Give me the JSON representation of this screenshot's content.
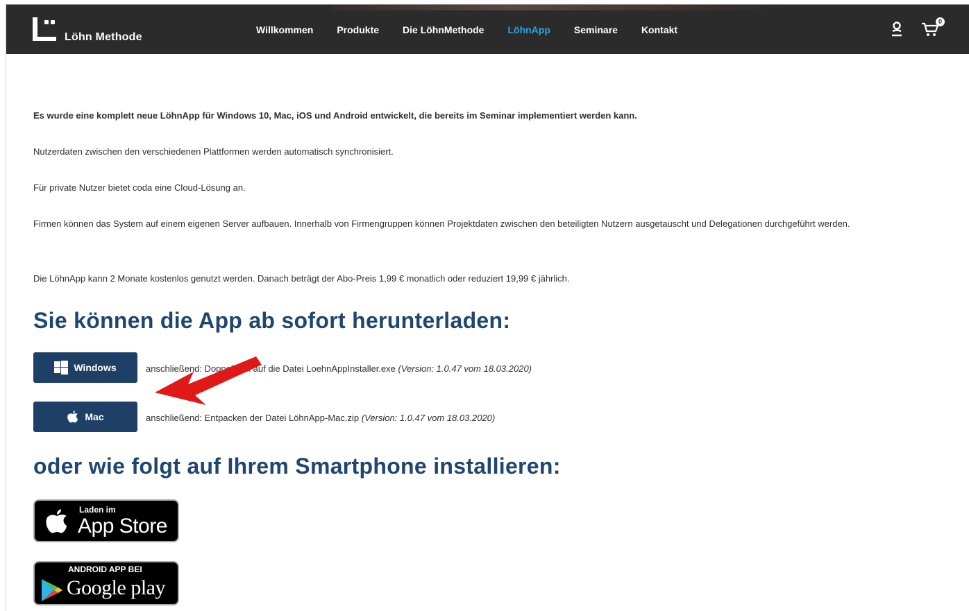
{
  "header": {
    "logo_text": "Löhn Methode",
    "nav": [
      "Willkommen",
      "Produkte",
      "Die LöhnMethode",
      "LöhnApp",
      "Seminare",
      "Kontakt"
    ],
    "active_nav": "LöhnApp",
    "cart_count": "0"
  },
  "main": {
    "paragraphs": [
      "Es wurde eine komplett neue LöhnApp für Windows 10, Mac, iOS und Android entwickelt, die bereits im Seminar implementiert werden kann.",
      "Nutzerdaten zwischen den verschiedenen Plattformen werden automatisch synchronisiert.",
      "Für private Nutzer bietet coda eine Cloud-Lösung an.",
      "Firmen können das System auf einem eigenen Server aufbauen. Innerhalb von Firmengruppen können Projektdaten zwischen den beteiligten Nutzern ausgetauscht und Delegationen durchgeführt werden.",
      "Die LöhnApp kann 2 Monate kostenlos genutzt werden. Danach beträgt der Abo-Preis 1,99 € monatlich oder reduziert 19,99 € jährlich."
    ],
    "download_heading": "Sie können die App ab sofort herunterladen:",
    "windows": {
      "label": "Windows",
      "text": "anschließend: Doppelklick auf die Datei LoehnAppInstaller.exe",
      "version": "(Version: 1.0.47 vom 18.03.2020)"
    },
    "mac": {
      "label": "Mac",
      "text": "anschließend: Entpacken der Datei LöhnApp-Mac.zip",
      "version": "(Version: 1.0.47 vom 18.03.2020)"
    },
    "smartphone_heading": "oder wie folgt auf Ihrem Smartphone installieren:",
    "appstore": {
      "small": "Laden im",
      "big": "App Store"
    },
    "googleplay": {
      "small": "ANDROID APP BEI",
      "big": "Google play"
    }
  },
  "colors": {
    "nav_active": "#29a8e0",
    "heading": "#1f4670",
    "button": "#1e3f66",
    "arrow": "#e01818"
  },
  "icons": [
    "user-icon",
    "cart-icon",
    "windows-icon",
    "apple-icon",
    "google-play-icon",
    "red-arrow"
  ]
}
